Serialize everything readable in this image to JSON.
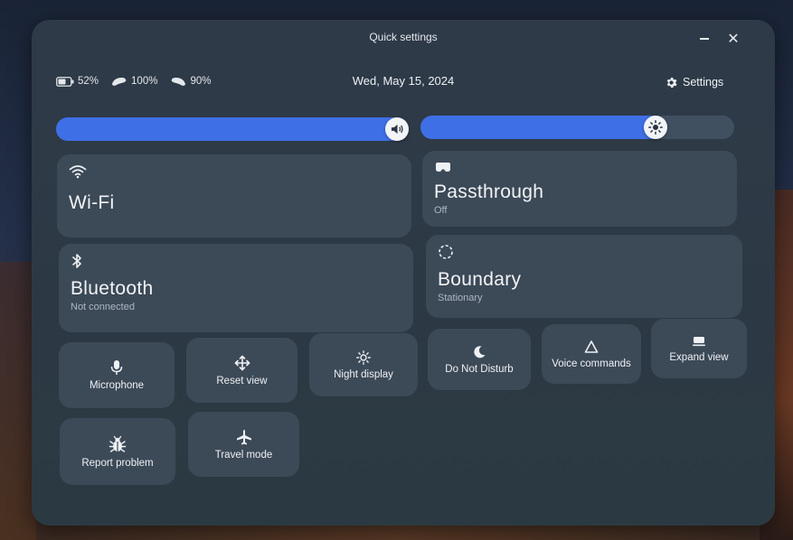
{
  "window": {
    "title": "Quick settings",
    "minimize_symbol": "",
    "close_symbol": "✕"
  },
  "status": {
    "headset_battery": "52%",
    "controller_left_battery": "100%",
    "controller_right_battery": "90%",
    "date": "Wed, May 15, 2024",
    "settings_label": "Settings"
  },
  "sliders": {
    "volume": {
      "level": 0.97,
      "icon": "speaker-icon"
    },
    "brightness": {
      "level": 0.75,
      "icon": "sun-icon"
    }
  },
  "tiles": {
    "wifi": {
      "label": "Wi-Fi",
      "sub": "",
      "icon": "wifi-icon"
    },
    "passthrough": {
      "label": "Passthrough",
      "sub": "Off",
      "icon": "headset-icon"
    },
    "bluetooth": {
      "label": "Bluetooth",
      "sub": "Not connected",
      "icon": "bluetooth-icon"
    },
    "boundary": {
      "label": "Boundary",
      "sub": "Stationary",
      "icon": "boundary-icon"
    },
    "microphone": {
      "label": "Microphone",
      "icon": "microphone-icon"
    },
    "reset_view": {
      "label": "Reset view",
      "icon": "move-arrows-icon"
    },
    "night_display": {
      "label": "Night display",
      "icon": "sun-small-icon"
    },
    "do_not_disturb": {
      "label": "Do Not Disturb",
      "icon": "moon-icon"
    },
    "voice_commands": {
      "label": "Voice commands",
      "icon": "triangle-icon"
    },
    "expand_view": {
      "label": "Expand view",
      "icon": "expand-view-icon"
    },
    "report_problem": {
      "label": "Report problem",
      "icon": "bug-icon"
    },
    "travel_mode": {
      "label": "Travel mode",
      "icon": "airplane-icon"
    }
  },
  "colors": {
    "accent": "#3f6fe6",
    "panel": "#2f3a48",
    "tile": "#3c4957"
  }
}
